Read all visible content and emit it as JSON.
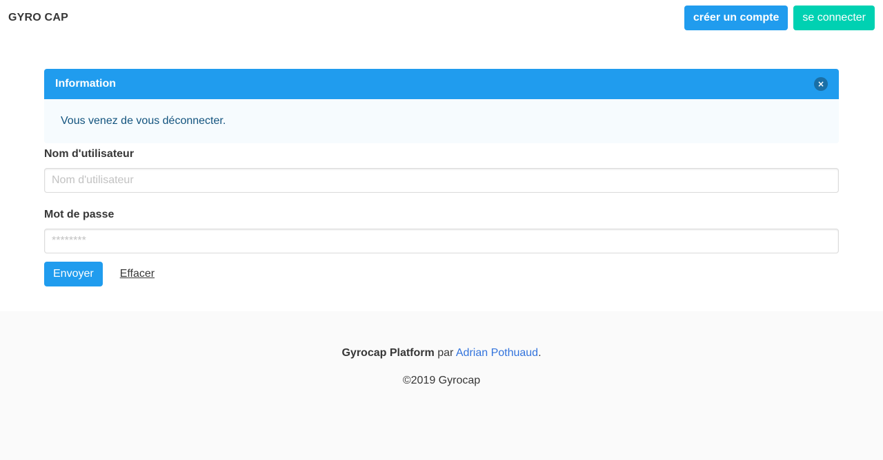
{
  "navbar": {
    "brand": "GYRO CAP",
    "create_account": "créer un compte",
    "login": "se connecter"
  },
  "message": {
    "title": "Information",
    "close": "×",
    "body": "Vous venez de vous déconnecter."
  },
  "form": {
    "username_label": "Nom d'utilisateur",
    "username_placeholder": "Nom d'utilisateur",
    "username_value": "",
    "password_label": "Mot de passe",
    "password_placeholder": "********",
    "password_value": "",
    "submit": "Envoyer",
    "clear": "Effacer"
  },
  "footer": {
    "platform": "Gyrocap Platform",
    "by": "par",
    "author": "Adrian Pothuaud",
    "period": ".",
    "copyright": "©2019 Gyrocap"
  },
  "colors": {
    "info": "#209cee",
    "primary": "#00d1b2",
    "link": "#3273dc"
  }
}
